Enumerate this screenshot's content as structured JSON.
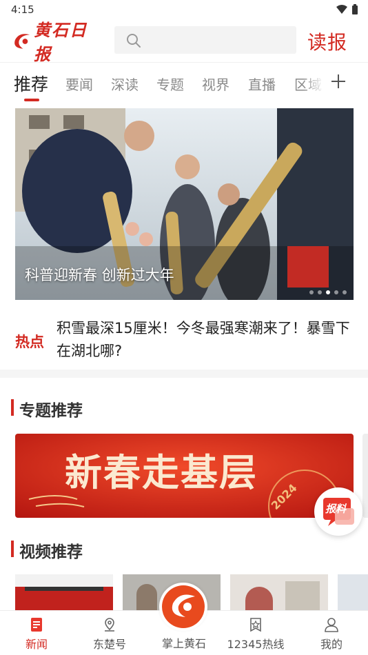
{
  "status_bar": {
    "time": "4:15"
  },
  "header": {
    "logo_text": "黄石日报",
    "search": {
      "placeholder": ""
    },
    "report_label": "读报"
  },
  "tabs": [
    {
      "label": "推荐",
      "active": true
    },
    {
      "label": "要闻"
    },
    {
      "label": "深读"
    },
    {
      "label": "专题"
    },
    {
      "label": "视界"
    },
    {
      "label": "直播"
    },
    {
      "label": "区域"
    }
  ],
  "carousel": {
    "caption": "科普迎新春 创新过大年",
    "slide_count": 5,
    "active_index": 3
  },
  "hot": {
    "label": "热点",
    "headline": "积雪最深15厘米！今冬最强寒潮来了！暴雪下在湖北哪?"
  },
  "topics": {
    "title": "专题推荐",
    "banner_text": "新春走基层",
    "banner_year": "2024"
  },
  "float_button": {
    "label": "报料"
  },
  "videos": {
    "title": "视频推荐"
  },
  "bottom_nav": [
    {
      "label": "新闻",
      "icon": "news-icon",
      "active": true
    },
    {
      "label": "东楚号",
      "icon": "location-icon"
    },
    {
      "label": "掌上黄石",
      "icon": "app-logo-icon"
    },
    {
      "label": "12345热线",
      "icon": "star-badge-icon"
    },
    {
      "label": "我的",
      "icon": "user-icon"
    }
  ],
  "colors": {
    "accent": "#d32a22",
    "text": "#222222",
    "muted": "#8a8a8a"
  }
}
